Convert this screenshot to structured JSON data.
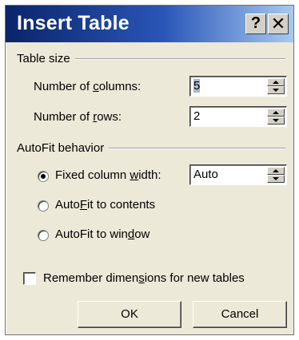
{
  "window": {
    "title": "Insert Table",
    "help_glyph": "?",
    "close_glyph": "✕"
  },
  "table_size": {
    "group_label": "Table size",
    "columns": {
      "label_pre": "Number of ",
      "label_ul": "c",
      "label_post": "olumns:",
      "value": "5"
    },
    "rows": {
      "label_pre": "Number of ",
      "label_ul": "r",
      "label_post": "ows:",
      "value": "2"
    }
  },
  "autofit": {
    "group_label": "AutoFit behavior",
    "options": [
      {
        "pre": "Fixed column ",
        "ul": "w",
        "post": "idth:",
        "selected": true
      },
      {
        "pre": "Auto",
        "ul": "F",
        "post": "it to contents",
        "selected": false
      },
      {
        "pre": "AutoFit to win",
        "ul": "d",
        "post": "ow",
        "selected": false
      }
    ],
    "fixed_width_value": "Auto"
  },
  "remember": {
    "pre": "Remember dimen",
    "ul": "s",
    "post": "ions for new tables",
    "checked": false
  },
  "buttons": {
    "ok": "OK",
    "cancel": "Cancel"
  }
}
